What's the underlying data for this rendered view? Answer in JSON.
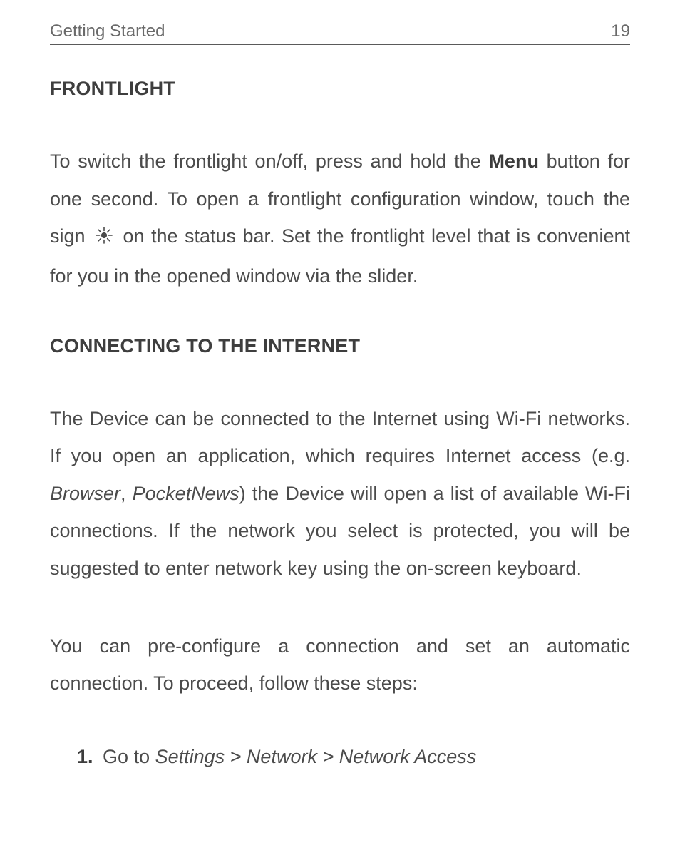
{
  "header": {
    "chapter": "Getting Started",
    "page_number": "19"
  },
  "section1": {
    "title": "FRONTLIGHT",
    "para1_part1": "To switch the frontlight on/off, press and hold the ",
    "para1_bold": "Menu",
    "para1_part2": " button for one second. To open a frontlight configuration window, touch the sign ",
    "icon_name": "brightness-icon",
    "para1_part3": " on the status bar. Set the frontlight level that is convenient for you in the opened window via the slider."
  },
  "section2": {
    "title": "CONNECTING TO THE INTERNET",
    "para1_part1": "The Device can be connected to the Internet using Wi-Fi networks. If you open an application, which requires Internet access (e.g. ",
    "para1_italic1": "Browser",
    "para1_mid": ", ",
    "para1_italic2": "PocketNews",
    "para1_part2": ") the Device will open a list of available Wi-Fi connections. If the network you select is protected, you will be suggested to enter network key using the on-screen keyboard.",
    "para2": "You can pre-configure a connection and set an automatic connection. To proceed, follow these steps:",
    "step1_num": "1.",
    "step1_text_pre": "Go to ",
    "step1_text_italic": "Settings > Network > Network Access"
  }
}
